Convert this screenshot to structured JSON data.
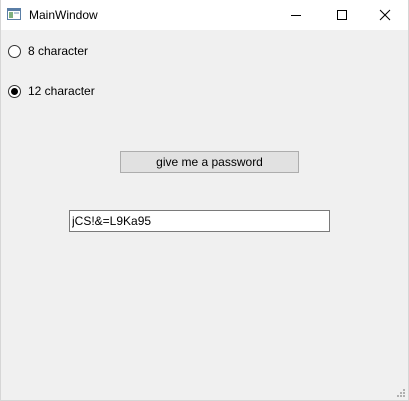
{
  "window": {
    "title": "MainWindow",
    "icons": {
      "app": "app-window-icon",
      "minimize": "minimize-icon",
      "maximize": "maximize-icon",
      "close": "close-icon",
      "grip": "resize-grip-icon"
    }
  },
  "options": {
    "opt8": {
      "label": "8 character",
      "checked": false
    },
    "opt12": {
      "label": "12 character",
      "checked": true
    }
  },
  "actions": {
    "generate_label": "give me a password"
  },
  "output": {
    "password_value": "jCS!&=L9Ka95"
  }
}
